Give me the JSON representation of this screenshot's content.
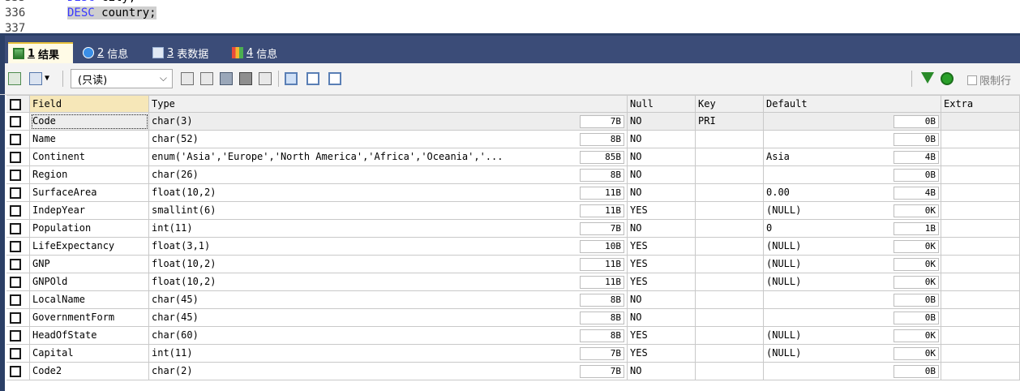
{
  "editor": {
    "lines": [
      {
        "num": "336",
        "keyword": "DESC",
        "rest": " country;"
      },
      {
        "num": "337",
        "keyword": "",
        "rest": ""
      }
    ]
  },
  "tabs": [
    {
      "num": "1",
      "label": "结果"
    },
    {
      "num": "2",
      "label": "信息"
    },
    {
      "num": "3",
      "label": "表数据"
    },
    {
      "num": "4",
      "label": "信息"
    }
  ],
  "toolbar": {
    "readonly_value": "(只读)",
    "limit_label": "限制行"
  },
  "table": {
    "columns": [
      "Field",
      "Type",
      "Null",
      "Key",
      "Default",
      "Extra"
    ],
    "rows": [
      {
        "field": "Code",
        "type": "char(3)",
        "type_size": "7B",
        "null": "NO",
        "key": "PRI",
        "default": "",
        "default_size": "0B",
        "extra": ""
      },
      {
        "field": "Name",
        "type": "char(52)",
        "type_size": "8B",
        "null": "NO",
        "key": "",
        "default": "",
        "default_size": "0B",
        "extra": ""
      },
      {
        "field": "Continent",
        "type": "enum('Asia','Europe','North America','Africa','Oceania','...",
        "type_size": "85B",
        "null": "NO",
        "key": "",
        "default": "Asia",
        "default_size": "4B",
        "extra": ""
      },
      {
        "field": "Region",
        "type": "char(26)",
        "type_size": "8B",
        "null": "NO",
        "key": "",
        "default": "",
        "default_size": "0B",
        "extra": ""
      },
      {
        "field": "SurfaceArea",
        "type": "float(10,2)",
        "type_size": "11B",
        "null": "NO",
        "key": "",
        "default": "0.00",
        "default_size": "4B",
        "extra": ""
      },
      {
        "field": "IndepYear",
        "type": "smallint(6)",
        "type_size": "11B",
        "null": "YES",
        "key": "",
        "default": "(NULL)",
        "default_size": "0K",
        "extra": ""
      },
      {
        "field": "Population",
        "type": "int(11)",
        "type_size": "7B",
        "null": "NO",
        "key": "",
        "default": "0",
        "default_size": "1B",
        "extra": ""
      },
      {
        "field": "LifeExpectancy",
        "type": "float(3,1)",
        "type_size": "10B",
        "null": "YES",
        "key": "",
        "default": "(NULL)",
        "default_size": "0K",
        "extra": ""
      },
      {
        "field": "GNP",
        "type": "float(10,2)",
        "type_size": "11B",
        "null": "YES",
        "key": "",
        "default": "(NULL)",
        "default_size": "0K",
        "extra": ""
      },
      {
        "field": "GNPOld",
        "type": "float(10,2)",
        "type_size": "11B",
        "null": "YES",
        "key": "",
        "default": "(NULL)",
        "default_size": "0K",
        "extra": ""
      },
      {
        "field": "LocalName",
        "type": "char(45)",
        "type_size": "8B",
        "null": "NO",
        "key": "",
        "default": "",
        "default_size": "0B",
        "extra": ""
      },
      {
        "field": "GovernmentForm",
        "type": "char(45)",
        "type_size": "8B",
        "null": "NO",
        "key": "",
        "default": "",
        "default_size": "0B",
        "extra": ""
      },
      {
        "field": "HeadOfState",
        "type": "char(60)",
        "type_size": "8B",
        "null": "YES",
        "key": "",
        "default": "(NULL)",
        "default_size": "0K",
        "extra": ""
      },
      {
        "field": "Capital",
        "type": "int(11)",
        "type_size": "7B",
        "null": "YES",
        "key": "",
        "default": "(NULL)",
        "default_size": "0K",
        "extra": ""
      },
      {
        "field": "Code2",
        "type": "char(2)",
        "type_size": "7B",
        "null": "NO",
        "key": "",
        "default": "",
        "default_size": "0B",
        "extra": ""
      }
    ]
  }
}
